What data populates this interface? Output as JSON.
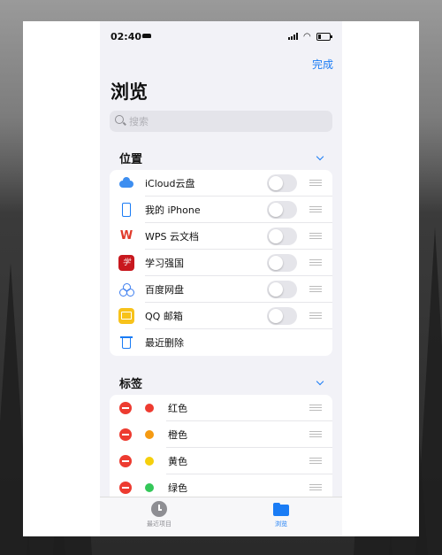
{
  "status": {
    "time": "02:40"
  },
  "nav": {
    "done_label": "完成",
    "title": "浏览"
  },
  "search": {
    "placeholder": "搜索"
  },
  "locations": {
    "header": "位置",
    "items": [
      {
        "label": "iCloud云盘",
        "icon": "icloud-icon",
        "enabled": false
      },
      {
        "label": "我的 iPhone",
        "icon": "iphone-icon",
        "enabled": false
      },
      {
        "label": "WPS 云文档",
        "icon": "wps-icon",
        "enabled": false
      },
      {
        "label": "学习强国",
        "icon": "xuexiqiangguo-icon",
        "enabled": false
      },
      {
        "label": "百度网盘",
        "icon": "baidu-netdisk-icon",
        "enabled": false
      },
      {
        "label": "QQ 邮箱",
        "icon": "qq-mail-icon",
        "enabled": false
      },
      {
        "label": "最近删除",
        "icon": "trash-icon"
      }
    ]
  },
  "tags": {
    "header": "标签",
    "items": [
      {
        "label": "红色",
        "color": "#ee3b30"
      },
      {
        "label": "橙色",
        "color": "#f59a12"
      },
      {
        "label": "黄色",
        "color": "#f5cf0c"
      },
      {
        "label": "绿色",
        "color": "#34c759"
      }
    ]
  },
  "tabbar": {
    "recents_label": "最近项目",
    "browse_label": "浏览"
  },
  "colors": {
    "accent": "#1a7cf5",
    "delete": "#ed3b30"
  }
}
